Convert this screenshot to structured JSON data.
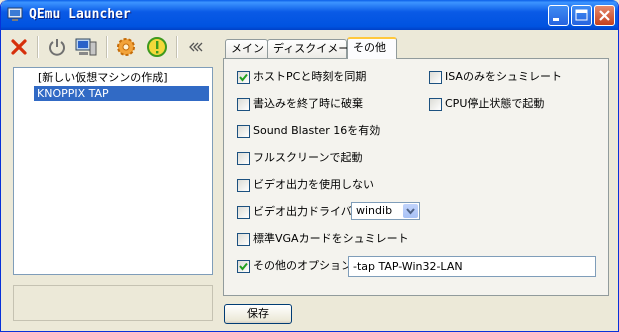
{
  "window": {
    "title": "QEmu Launcher"
  },
  "title_buttons": [
    "minimize-icon",
    "maximize-icon",
    "close-icon"
  ],
  "toolbar": {
    "icons": [
      "delete-icon",
      "power-icon",
      "computer-icon",
      "settings-gear-icon",
      "warning-icon",
      "collapse-chevrons-icon"
    ]
  },
  "vm_list": {
    "items": [
      {
        "label": "[新しい仮想マシンの作成]",
        "selected": false
      },
      {
        "label": "KNOPPIX TAP",
        "selected": true
      }
    ]
  },
  "tabs": [
    {
      "label": "メイン",
      "active": false
    },
    {
      "label": "ディスクイメージ",
      "active": false
    },
    {
      "label": "その他",
      "active": true
    }
  ],
  "options": {
    "sync_host_time": {
      "label": "ホストPCと時刻を同期",
      "checked": true
    },
    "isa_only": {
      "label": "ISAのみをシュミレート",
      "checked": false
    },
    "discard_writes": {
      "label": "書込みを終了時に破棄",
      "checked": false
    },
    "cpu_stopped": {
      "label": "CPU停止状態で起動",
      "checked": false
    },
    "soundblaster": {
      "label": "Sound Blaster 16を有効",
      "checked": false
    },
    "fullscreen": {
      "label": "フルスクリーンで起動",
      "checked": false
    },
    "no_video": {
      "label": "ビデオ出力を使用しない",
      "checked": false
    },
    "video_driver": {
      "label": "ビデオ出力ドライバ",
      "checked": false,
      "value": "windib"
    },
    "std_vga": {
      "label": "標準VGAカードをシュミレート",
      "checked": false
    },
    "other_options": {
      "label": "その他のオプション",
      "checked": true,
      "value": "-tap TAP-Win32-LAN"
    }
  },
  "save_button": {
    "label": "保存"
  },
  "colors": {
    "title_bar": "#0a5ae6",
    "selection": "#316ac5",
    "window_bg": "#ece9d8",
    "check": "#21a121"
  }
}
